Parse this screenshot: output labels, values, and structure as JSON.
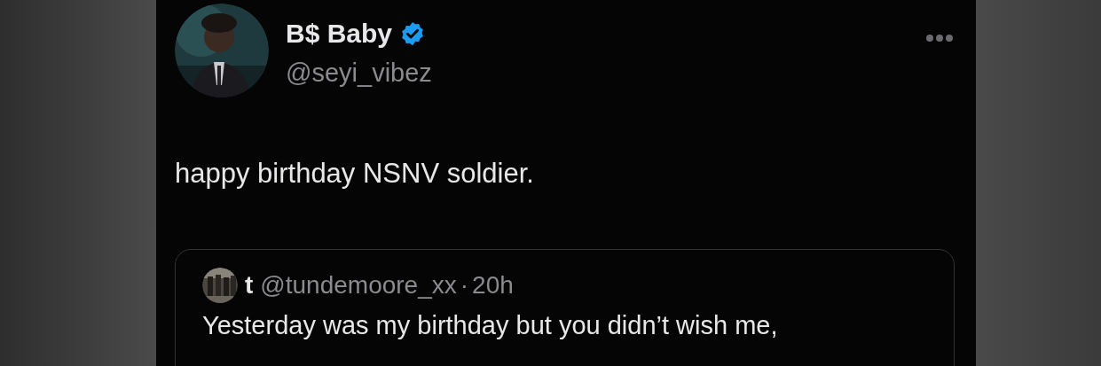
{
  "tweet": {
    "author": {
      "name": "B$ Baby",
      "verified": true,
      "handle": "@seyi_vibez"
    },
    "more_menu": true,
    "text": "happy birthday NSNV soldier.",
    "quoted_tweet": {
      "name": "t",
      "handle": "@tundemoore_xx",
      "separator": "·",
      "time": "20h",
      "text": "Yesterday was my birthday but you didn’t wish me,"
    }
  }
}
